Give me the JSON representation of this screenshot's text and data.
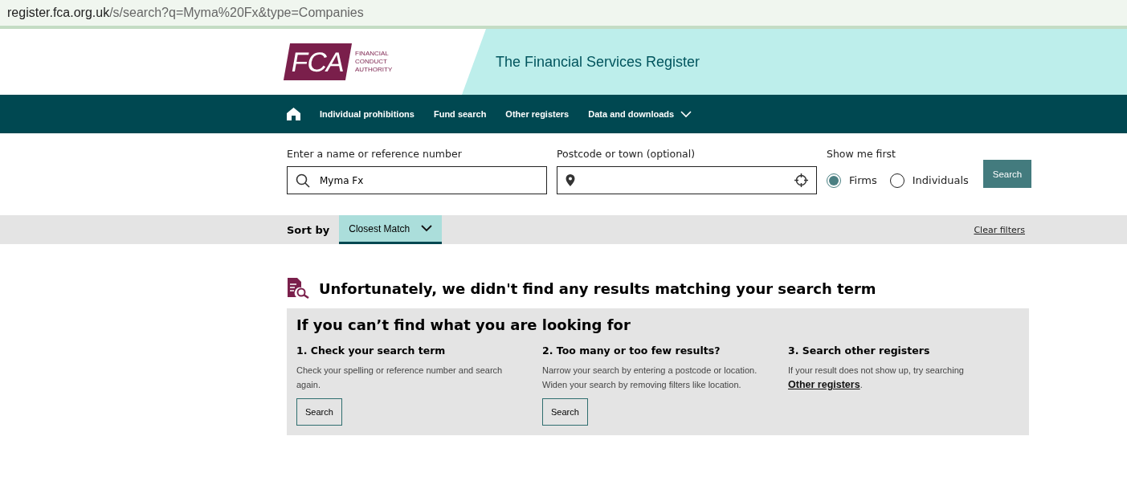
{
  "address_bar": {
    "host": "register.fca.org.uk",
    "path": "/s/search?q=Myma%20Fx&type=Companies"
  },
  "header": {
    "logo_mark": "FCA",
    "logo_words": [
      "FINANCIAL",
      "CONDUCT",
      "AUTHORITY"
    ],
    "title": "The Financial Services Register"
  },
  "nav": [
    {
      "kind": "home"
    },
    {
      "kind": "link",
      "label": "Individual prohibitions"
    },
    {
      "kind": "link",
      "label": "Fund search"
    },
    {
      "kind": "link",
      "label": "Other registers"
    },
    {
      "kind": "menu",
      "label": "Data and downloads"
    }
  ],
  "search": {
    "name_label": "Enter a name or reference number",
    "name_value": "Myma Fx",
    "postcode_label": "Postcode or town (optional)",
    "show_label": "Show me first",
    "options": [
      {
        "label": "Firms",
        "selected": true
      },
      {
        "label": "Individuals",
        "selected": false
      }
    ],
    "button": "Search"
  },
  "sort": {
    "label": "Sort by",
    "value": "Closest Match",
    "clear": "Clear filters"
  },
  "results": {
    "message": "Unfortunately, we didn't find any results matching your search term",
    "help_title": "If you can’t find what you are looking for",
    "columns": [
      {
        "heading": "1. Check your search term",
        "text": "Check your spelling or reference number and search again.",
        "button": "Search"
      },
      {
        "heading": "2. Too many or too few results?",
        "text": "Narrow your search by entering a postcode or location. Widen your search by removing filters like location.",
        "button": "Search"
      },
      {
        "heading": "3. Search other registers",
        "text": "If your result does not show up, try searching ",
        "link": "Other registers",
        "text_after": "."
      }
    ]
  }
}
